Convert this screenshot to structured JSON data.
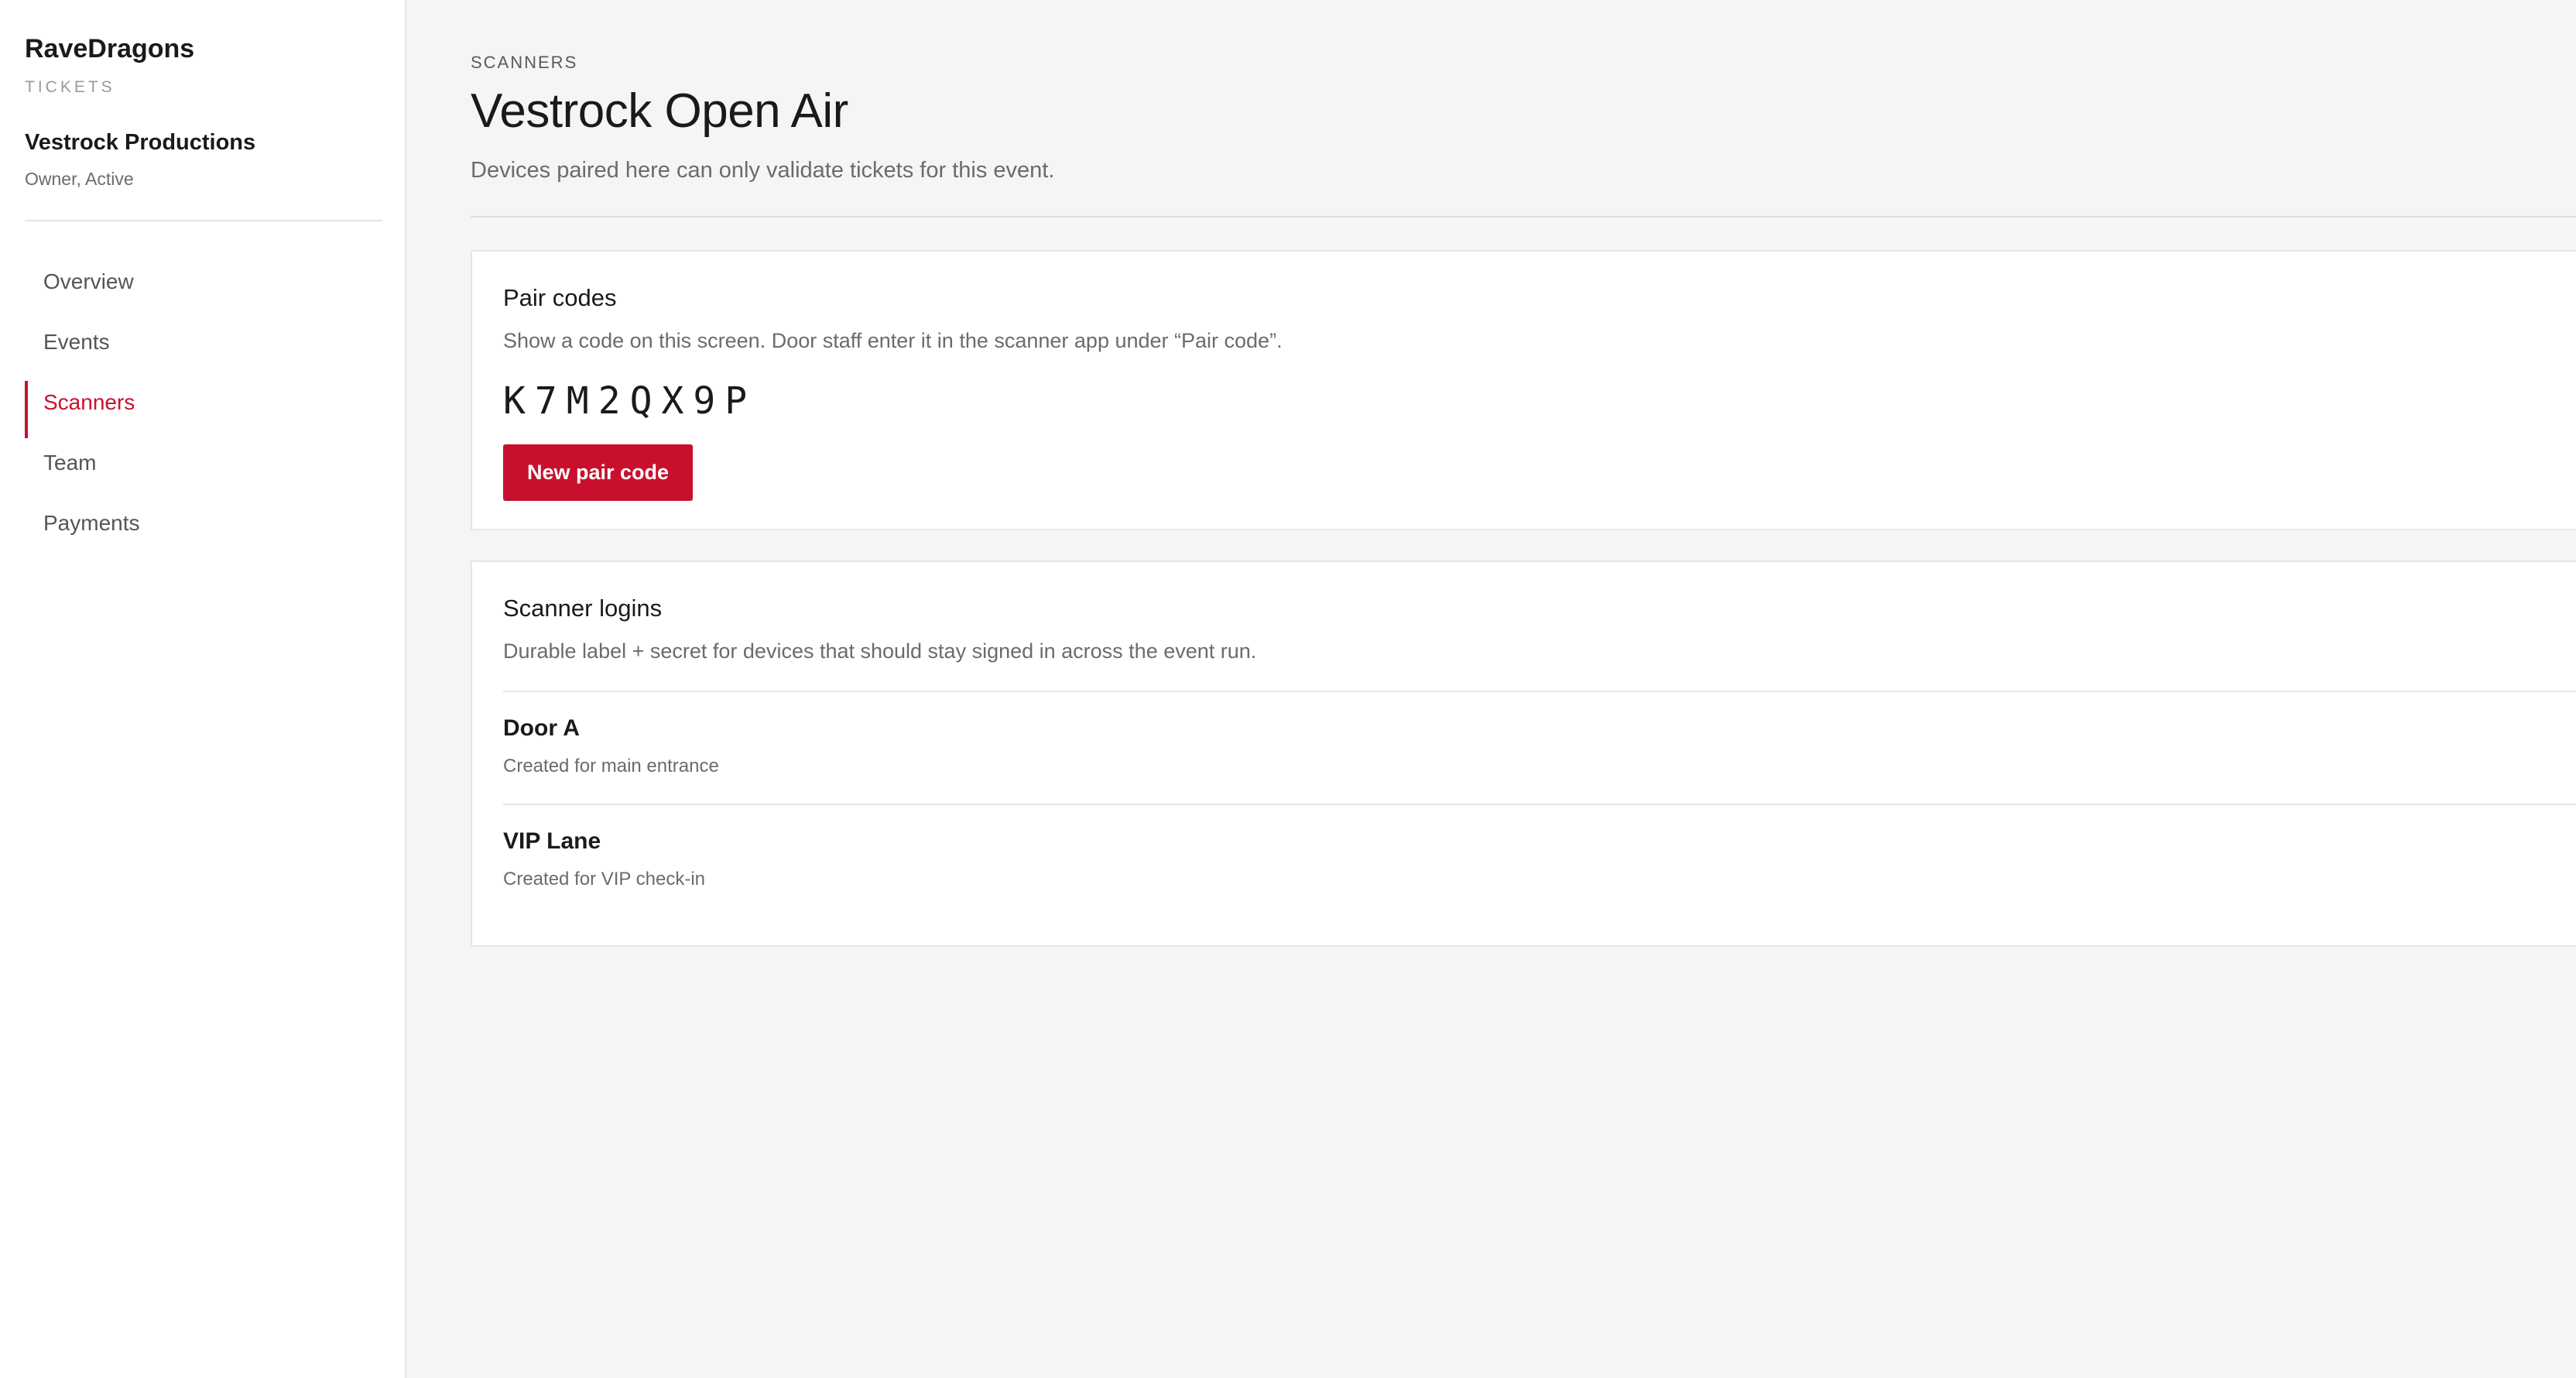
{
  "sidebar": {
    "brand": {
      "name": "RaveDragons",
      "subtitle": "TICKETS"
    },
    "organization": {
      "name": "Vestrock Productions",
      "role": "Owner, Active"
    },
    "nav": [
      {
        "label": "Overview",
        "active": false
      },
      {
        "label": "Events",
        "active": false
      },
      {
        "label": "Scanners",
        "active": true
      },
      {
        "label": "Team",
        "active": false
      },
      {
        "label": "Payments",
        "active": false
      }
    ]
  },
  "header": {
    "eyebrow": "SCANNERS",
    "title": "Vestrock Open Air",
    "description": "Devices paired here can only validate tickets for this event."
  },
  "pair_codes": {
    "title": "Pair codes",
    "description": "Show a code on this screen. Door staff enter it in the scanner app under “Pair code”.",
    "code": "K7M2QX9P",
    "button_label": "New pair code"
  },
  "scanner_logins": {
    "title": "Scanner logins",
    "description": "Durable label + secret for devices that should stay signed in across the event run.",
    "items": [
      {
        "name": "Door A",
        "note": "Created for main entrance"
      },
      {
        "name": "VIP Lane",
        "note": "Created for VIP check-in"
      }
    ]
  },
  "colors": {
    "accent": "#c8102e",
    "background": "#f5f5f5",
    "surface": "#ffffff"
  }
}
